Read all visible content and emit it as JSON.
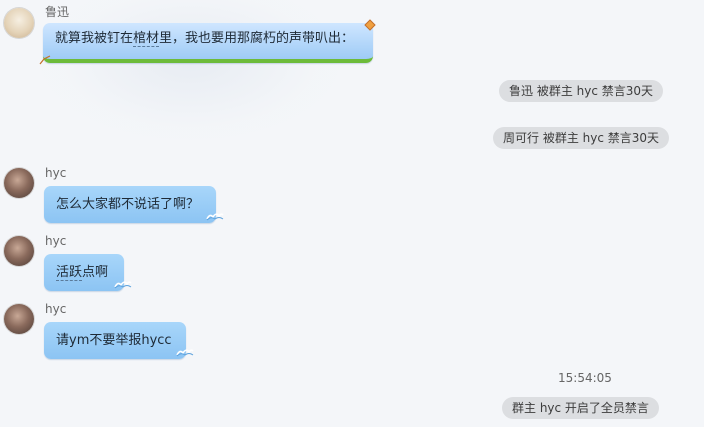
{
  "messages": [
    {
      "sender": "鲁迅",
      "text_before": "就算我被钉在",
      "text_under": "棺材",
      "text_after": "里，我也要用那腐朽的声带叭出："
    },
    {
      "sender": "hyc",
      "text": "怎么大家都不说话了啊？"
    },
    {
      "sender": "hyc",
      "text_under": "活跃",
      "text_after": "点啊"
    },
    {
      "sender": "hyc",
      "text": "请ym不要举报hycc"
    }
  ],
  "system": [
    "鲁迅 被群主 hyc 禁言30天",
    "周可行 被群主 hyc 禁言30天",
    "群主 hyc 开启了全员禁言"
  ],
  "timestamp": "15:54:05",
  "icons": {
    "luxun_avatar": "person-avatar-icon",
    "hyc_avatar": "person-avatar-icon",
    "bubble_decor": "kite-icon",
    "bubble_wave": "wave-icon"
  }
}
